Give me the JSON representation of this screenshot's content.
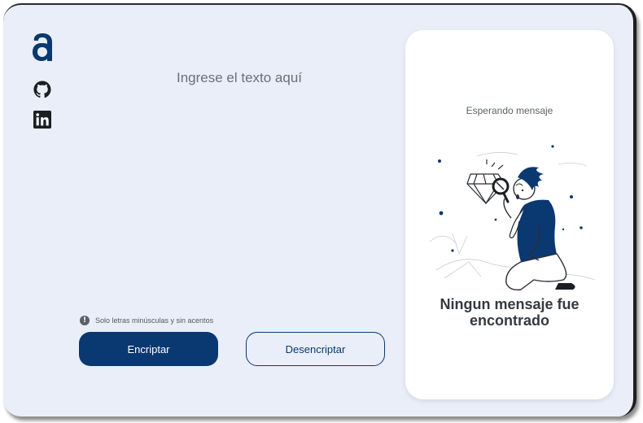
{
  "sidebar": {
    "logo_icon": "alura-logo-icon",
    "links": [
      {
        "name": "github",
        "icon": "github-icon"
      },
      {
        "name": "linkedin",
        "icon": "linkedin-icon"
      }
    ]
  },
  "input": {
    "placeholder": "Ingrese el texto aquí",
    "value": ""
  },
  "hint": {
    "icon": "exclamation-circle-icon",
    "text": "Solo letras minúsculas y sin acentos"
  },
  "buttons": {
    "encrypt_label": "Encriptar",
    "decrypt_label": "Desencriptar"
  },
  "output": {
    "status": "Esperando mensaje",
    "empty_title_line1": "Ningun mensaje fue",
    "empty_title_line2": "encontrado",
    "illustration": "person-with-magnifier-illustration"
  },
  "colors": {
    "primary": "#0a3871",
    "background": "#eaeef9",
    "card": "#ffffff",
    "heading": "#343a40"
  }
}
